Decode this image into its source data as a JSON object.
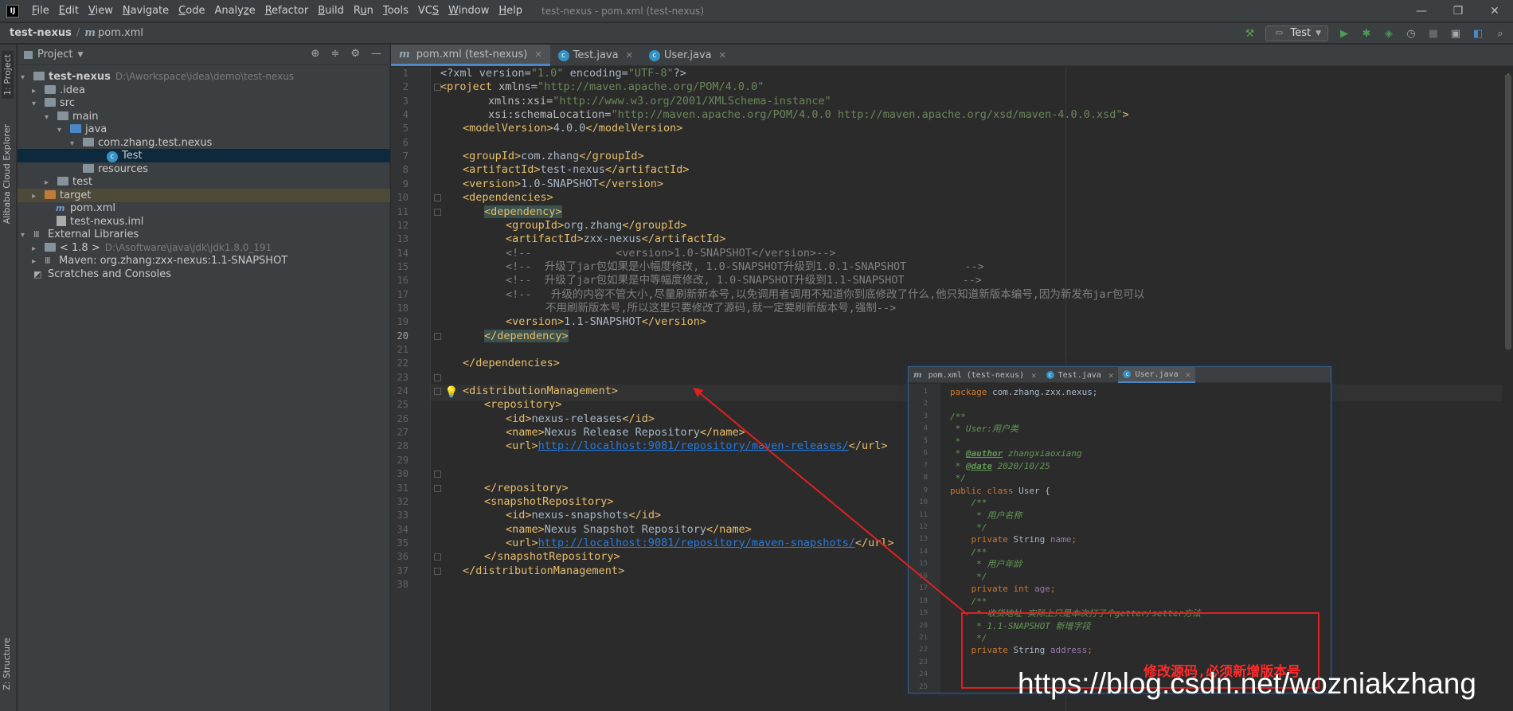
{
  "menubar": {
    "items": [
      "File",
      "Edit",
      "View",
      "Navigate",
      "Code",
      "Analyze",
      "Refactor",
      "Build",
      "Run",
      "Tools",
      "VCS",
      "Window",
      "Help"
    ],
    "underline_letters": [
      "F",
      "E",
      "V",
      "N",
      "C",
      "z",
      "R",
      "B",
      "u",
      "T",
      "S",
      "W",
      "H"
    ],
    "window_title": "test-nexus - pom.xml (test-nexus)"
  },
  "navbar": {
    "project": "test-nexus",
    "file": "pom.xml",
    "run_config": "Test"
  },
  "left_stripe": {
    "project_tab": "1: Project",
    "cloud_tab": "Alibaba Cloud Explorer",
    "structure_tab": "Z: Structure"
  },
  "project_panel": {
    "title": "Project",
    "tree": [
      {
        "label": "test-nexus",
        "path": "D:\\Aworkspace\\idea\\demo\\test-nexus"
      },
      {
        "label": ".idea"
      },
      {
        "label": "src"
      },
      {
        "label": "main"
      },
      {
        "label": "java"
      },
      {
        "label": "com.zhang.test.nexus"
      },
      {
        "label": "Test"
      },
      {
        "label": "resources"
      },
      {
        "label": "test"
      },
      {
        "label": "target"
      },
      {
        "label": "pom.xml"
      },
      {
        "label": "test-nexus.iml"
      },
      {
        "label": "External Libraries"
      },
      {
        "label": "< 1.8 >",
        "path": "D:\\Asoftware\\java\\jdk\\jdk1.8.0_191"
      },
      {
        "label": "Maven: org.zhang:zxx-nexus:1.1-SNAPSHOT"
      },
      {
        "label": "Scratches and Consoles"
      }
    ]
  },
  "editor_tabs": [
    "pom.xml (test-nexus)",
    "Test.java",
    "User.java"
  ],
  "editor": {
    "line_numbers": [
      "1",
      "2",
      "3",
      "4",
      "5",
      "6",
      "7",
      "8",
      "9",
      "10",
      "11",
      "12",
      "13",
      "14",
      "15",
      "16",
      "17",
      "18",
      "19",
      "20",
      "21",
      "22",
      "23",
      "24",
      "25",
      "26",
      "27",
      "28",
      "29",
      "30",
      "31",
      "32",
      "33",
      "34",
      "35",
      "36",
      "37",
      "38"
    ],
    "lines": {
      "l1_a": "<?xml version=",
      "l1_b": "\"1.0\"",
      "l1_c": " encoding=",
      "l1_d": "\"UTF-8\"",
      "l1_e": "?>",
      "l2_a": "<project ",
      "l2_b": "xmlns=",
      "l2_c": "\"http://maven.apache.org/POM/4.0.0\"",
      "l3_a": "xmlns:xsi=",
      "l3_b": "\"http://www.w3.org/2001/XMLSchema-instance\"",
      "l4_a": "xsi:schemaLocation=",
      "l4_b": "\"http://maven.apache.org/POM/4.0.0 http://maven.apache.org/xsd/maven-4.0.0.xsd\"",
      "l4_c": ">",
      "l5_a": "<modelVersion>",
      "l5_b": "4.0.0",
      "l5_c": "</modelVersion>",
      "l7_a": "<groupId>",
      "l7_b": "com.zhang",
      "l7_c": "</groupId>",
      "l8_a": "<artifactId>",
      "l8_b": "test-nexus",
      "l8_c": "</artifactId>",
      "l9_a": "<version>",
      "l9_b": "1.0-SNAPSHOT",
      "l9_c": "</version>",
      "l10": "<dependencies>",
      "l11": "<dependency>",
      "l12_a": "<groupId>",
      "l12_b": "org.zhang",
      "l12_c": "</groupId>",
      "l13_a": "<artifactId>",
      "l13_b": "zxx-nexus",
      "l13_c": "</artifactId>",
      "l14": "<!--             <version>1.0-SNAPSHOT</version>-->",
      "l15": "<!--  升级了jar包如果是小幅度修改, 1.0-SNAPSHOT升级到1.0.1-SNAPSHOT         -->",
      "l16": "<!--  升级了jar包如果是中等幅度修改, 1.0-SNAPSHOT升级到1.1-SNAPSHOT         -->",
      "l17": "<!--   升级的内容不管大小,尽量刷新新本号,以免调用者调用不知道你到底修改了什么,他只知道新版本编号,因为新发布jar包可以",
      "l17b": "不用刷新版本号,所以这里只要修改了源码,就一定要刷新版本号,强制-->",
      "l18_a": "<version>",
      "l18_b": "1.1-SNAPSHOT",
      "l18_c": "</version>",
      "l19": "</dependency>",
      "l21": "</dependencies>",
      "l23": "<distributionManagement>",
      "l24": "<repository>",
      "l25_a": "<id>",
      "l25_b": "nexus-releases",
      "l25_c": "</id>",
      "l26_a": "<name>",
      "l26_b": "Nexus Release Repository",
      "l26_c": "</name>",
      "l27_a": "<url>",
      "l27_b": "http://localhost:9081/repository/maven-releases/",
      "l27_c": "</url>",
      "l30": "</repository>",
      "l31": "<snapshotRepository>",
      "l32_a": "<id>",
      "l32_b": "nexus-snapshots",
      "l32_c": "</id>",
      "l33_a": "<name>",
      "l33_b": "Nexus Snapshot Repository",
      "l33_c": "</name>",
      "l34_a": "<url>",
      "l34_b": "http://localhost:9081/repository/maven-snapshots/",
      "l34_c": "</url>",
      "l35": "</snapshotRepository>",
      "l36": "</distributionManagement>"
    }
  },
  "overlay": {
    "tabs": [
      "pom.xml (test-nexus)",
      "Test.java",
      "User.java"
    ],
    "line_numbers": [
      "1",
      "2",
      "3",
      "4",
      "5",
      "6",
      "7",
      "8",
      "9",
      "10",
      "11",
      "12",
      "13",
      "14",
      "15",
      "16",
      "17",
      "18",
      "19",
      "20",
      "21",
      "22",
      "23",
      "24",
      "25"
    ],
    "lines": {
      "o1_a": "package",
      "o1_b": " com.zhang.zxx.nexus;",
      "o3": "/**",
      "o4": " * User:用户类",
      "o5": " *",
      "o6_a": " * ",
      "o6_b": "@author",
      "o6_c": " zhangxiaoxiang",
      "o7_a": " * ",
      "o7_b": "@date",
      "o7_c": " 2020/10/25",
      "o8": " */",
      "o9_a": "public class ",
      "o9_b": "User",
      "o9_c": " {",
      "o10": "    /**",
      "o11": "     * 用户名称",
      "o12": "     */",
      "o13_a": "    private ",
      "o13_b": "String ",
      "o13_c": "name",
      "o13_d": ";",
      "o14": "    /**",
      "o15": "     * 用户年龄",
      "o16": "     */",
      "o17_a": "    private int ",
      "o17_b": "age",
      "o17_c": ";",
      "o18": "    /**",
      "o19": "     * 收货地址 实际上只是本次打了个getter/setter方法",
      "o20": "     * 1.1-SNAPSHOT 新增字段",
      "o21": "     */",
      "o22_a": "    private ",
      "o22_b": "String ",
      "o22_c": "address",
      "o22_d": ";"
    },
    "note": "修改源码,必须新增版本号"
  },
  "watermark": "https://blog.csdn.net/wozniakzhang",
  "colors": {
    "arrow": "#e02020",
    "accent": "#4a88c7"
  }
}
